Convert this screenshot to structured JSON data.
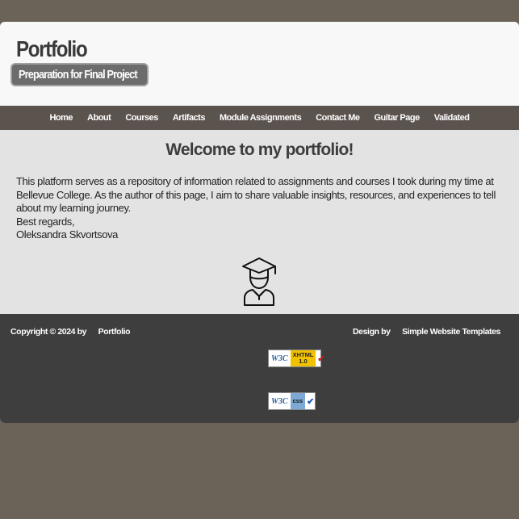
{
  "header": {
    "title": "Portfolio",
    "subtitle": "Preparation for Final Project"
  },
  "nav": {
    "items": [
      "Home",
      "About",
      "Courses",
      "Artifacts",
      "Module Assignments",
      "Contact Me",
      "Guitar Page",
      "Validated"
    ]
  },
  "main": {
    "heading": "Welcome to my portfolio!",
    "paragraph": "This platform serves as a repository of information related to assignments and courses I took during my time at Bellevue College. As the author of this page, I aim to share valuable insights, resources, and experiences to tell about my learning journey.",
    "signoff": "Best regards,",
    "author": "Oleksandra Skvortsova",
    "icon": "graduate-icon"
  },
  "footer": {
    "copyright": "Copyright © 2024 by",
    "copyright_link": "Portfolio",
    "design_label": "Design by",
    "design_link": "Simple Website Templates",
    "badges": {
      "xhtml": {
        "w3c": "W3C",
        "label_line1": "XHTML",
        "label_line2": "1.0"
      },
      "css": {
        "w3c": "W3C",
        "label_line1": "css"
      }
    }
  },
  "colors": {
    "background": "#6b6358",
    "nav": "#5b534e",
    "footer": "#3e3e3e",
    "header": "#f8f8f8",
    "content": "#e3e3e3"
  }
}
